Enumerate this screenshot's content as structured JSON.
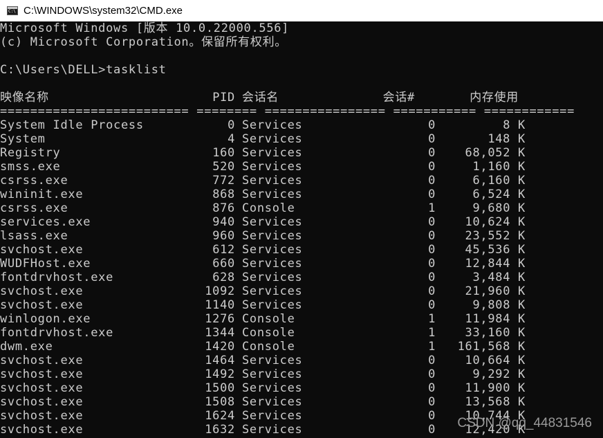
{
  "window": {
    "title": "C:\\WINDOWS\\system32\\CMD.exe",
    "icon": "cmd-icon"
  },
  "console": {
    "banner_line1": "Microsoft Windows [版本 10.0.22000.556]",
    "banner_line2": "(c) Microsoft Corporation。保留所有权利。",
    "prompt": "C:\\Users\\DELL>tasklist",
    "headers": {
      "image_name": "映像名称",
      "pid": "PID",
      "session_name": "会话名",
      "session_num": "会话#",
      "mem_usage": "内存使用"
    },
    "separator": "========================= ======== ================ =========== ============",
    "rows": [
      {
        "name": "System Idle Process",
        "pid": "0",
        "session": "Services",
        "num": "0",
        "mem": "8 K"
      },
      {
        "name": "System",
        "pid": "4",
        "session": "Services",
        "num": "0",
        "mem": "148 K"
      },
      {
        "name": "Registry",
        "pid": "160",
        "session": "Services",
        "num": "0",
        "mem": "68,052 K"
      },
      {
        "name": "smss.exe",
        "pid": "520",
        "session": "Services",
        "num": "0",
        "mem": "1,160 K"
      },
      {
        "name": "csrss.exe",
        "pid": "772",
        "session": "Services",
        "num": "0",
        "mem": "6,160 K"
      },
      {
        "name": "wininit.exe",
        "pid": "868",
        "session": "Services",
        "num": "0",
        "mem": "6,524 K"
      },
      {
        "name": "csrss.exe",
        "pid": "876",
        "session": "Console",
        "num": "1",
        "mem": "9,680 K"
      },
      {
        "name": "services.exe",
        "pid": "940",
        "session": "Services",
        "num": "0",
        "mem": "10,624 K"
      },
      {
        "name": "lsass.exe",
        "pid": "960",
        "session": "Services",
        "num": "0",
        "mem": "23,552 K"
      },
      {
        "name": "svchost.exe",
        "pid": "612",
        "session": "Services",
        "num": "0",
        "mem": "45,536 K"
      },
      {
        "name": "WUDFHost.exe",
        "pid": "660",
        "session": "Services",
        "num": "0",
        "mem": "12,844 K"
      },
      {
        "name": "fontdrvhost.exe",
        "pid": "628",
        "session": "Services",
        "num": "0",
        "mem": "3,484 K"
      },
      {
        "name": "svchost.exe",
        "pid": "1092",
        "session": "Services",
        "num": "0",
        "mem": "21,960 K"
      },
      {
        "name": "svchost.exe",
        "pid": "1140",
        "session": "Services",
        "num": "0",
        "mem": "9,808 K"
      },
      {
        "name": "winlogon.exe",
        "pid": "1276",
        "session": "Console",
        "num": "1",
        "mem": "11,984 K"
      },
      {
        "name": "fontdrvhost.exe",
        "pid": "1344",
        "session": "Console",
        "num": "1",
        "mem": "33,160 K"
      },
      {
        "name": "dwm.exe",
        "pid": "1420",
        "session": "Console",
        "num": "1",
        "mem": "161,568 K"
      },
      {
        "name": "svchost.exe",
        "pid": "1464",
        "session": "Services",
        "num": "0",
        "mem": "10,664 K"
      },
      {
        "name": "svchost.exe",
        "pid": "1492",
        "session": "Services",
        "num": "0",
        "mem": "9,292 K"
      },
      {
        "name": "svchost.exe",
        "pid": "1500",
        "session": "Services",
        "num": "0",
        "mem": "11,900 K"
      },
      {
        "name": "svchost.exe",
        "pid": "1508",
        "session": "Services",
        "num": "0",
        "mem": "13,568 K"
      },
      {
        "name": "svchost.exe",
        "pid": "1624",
        "session": "Services",
        "num": "0",
        "mem": "10,744 K"
      },
      {
        "name": "svchost.exe",
        "pid": "1632",
        "session": "Services",
        "num": "0",
        "mem": "12,420 K"
      }
    ]
  },
  "watermark": "CSDN @qq_44831546",
  "colors": {
    "console_bg": "#0c0c0c",
    "console_text": "#cccccc",
    "titlebar_bg": "#ffffff"
  }
}
